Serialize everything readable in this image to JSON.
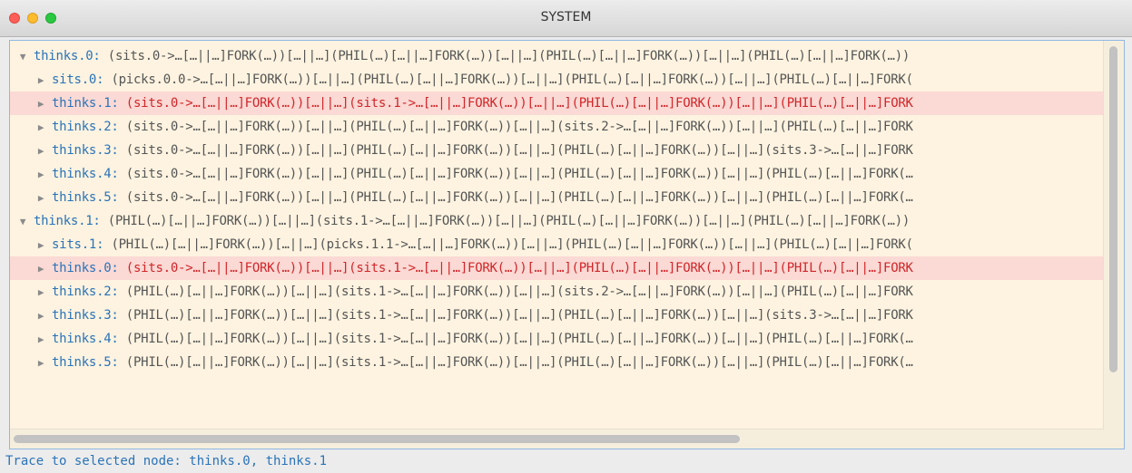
{
  "window": {
    "title": "SYSTEM"
  },
  "tree": {
    "rows": [
      {
        "level": 0,
        "expanded": true,
        "selected": false,
        "name": "thinks.0:",
        "text": " (sits.0->…[…||…]FORK(…))[…||…](PHIL(…)[…||…]FORK(…))[…||…](PHIL(…)[…||…]FORK(…))[…||…](PHIL(…)[…||…]FORK(…))"
      },
      {
        "level": 1,
        "expanded": false,
        "selected": false,
        "name": "sits.0:",
        "text": " (picks.0.0->…[…||…]FORK(…))[…||…](PHIL(…)[…||…]FORK(…))[…||…](PHIL(…)[…||…]FORK(…))[…||…](PHIL(…)[…||…]FORK("
      },
      {
        "level": 1,
        "expanded": false,
        "selected": true,
        "name": "thinks.1:",
        "text": " (sits.0->…[…||…]FORK(…))[…||…](sits.1->…[…||…]FORK(…))[…||…](PHIL(…)[…||…]FORK(…))[…||…](PHIL(…)[…||…]FORK"
      },
      {
        "level": 1,
        "expanded": false,
        "selected": false,
        "name": "thinks.2:",
        "text": " (sits.0->…[…||…]FORK(…))[…||…](PHIL(…)[…||…]FORK(…))[…||…](sits.2->…[…||…]FORK(…))[…||…](PHIL(…)[…||…]FORK"
      },
      {
        "level": 1,
        "expanded": false,
        "selected": false,
        "name": "thinks.3:",
        "text": " (sits.0->…[…||…]FORK(…))[…||…](PHIL(…)[…||…]FORK(…))[…||…](PHIL(…)[…||…]FORK(…))[…||…](sits.3->…[…||…]FORK"
      },
      {
        "level": 1,
        "expanded": false,
        "selected": false,
        "name": "thinks.4:",
        "text": " (sits.0->…[…||…]FORK(…))[…||…](PHIL(…)[…||…]FORK(…))[…||…](PHIL(…)[…||…]FORK(…))[…||…](PHIL(…)[…||…]FORK(…"
      },
      {
        "level": 1,
        "expanded": false,
        "selected": false,
        "name": "thinks.5:",
        "text": " (sits.0->…[…||…]FORK(…))[…||…](PHIL(…)[…||…]FORK(…))[…||…](PHIL(…)[…||…]FORK(…))[…||…](PHIL(…)[…||…]FORK(…"
      },
      {
        "level": 0,
        "expanded": true,
        "selected": false,
        "name": "thinks.1:",
        "text": " (PHIL(…)[…||…]FORK(…))[…||…](sits.1->…[…||…]FORK(…))[…||…](PHIL(…)[…||…]FORK(…))[…||…](PHIL(…)[…||…]FORK(…))"
      },
      {
        "level": 1,
        "expanded": false,
        "selected": false,
        "name": "sits.1:",
        "text": " (PHIL(…)[…||…]FORK(…))[…||…](picks.1.1->…[…||…]FORK(…))[…||…](PHIL(…)[…||…]FORK(…))[…||…](PHIL(…)[…||…]FORK("
      },
      {
        "level": 1,
        "expanded": false,
        "selected": true,
        "name": "thinks.0:",
        "text": " (sits.0->…[…||…]FORK(…))[…||…](sits.1->…[…||…]FORK(…))[…||…](PHIL(…)[…||…]FORK(…))[…||…](PHIL(…)[…||…]FORK"
      },
      {
        "level": 1,
        "expanded": false,
        "selected": false,
        "name": "thinks.2:",
        "text": " (PHIL(…)[…||…]FORK(…))[…||…](sits.1->…[…||…]FORK(…))[…||…](sits.2->…[…||…]FORK(…))[…||…](PHIL(…)[…||…]FORK"
      },
      {
        "level": 1,
        "expanded": false,
        "selected": false,
        "name": "thinks.3:",
        "text": " (PHIL(…)[…||…]FORK(…))[…||…](sits.1->…[…||…]FORK(…))[…||…](PHIL(…)[…||…]FORK(…))[…||…](sits.3->…[…||…]FORK"
      },
      {
        "level": 1,
        "expanded": false,
        "selected": false,
        "name": "thinks.4:",
        "text": " (PHIL(…)[…||…]FORK(…))[…||…](sits.1->…[…||…]FORK(…))[…||…](PHIL(…)[…||…]FORK(…))[…||…](PHIL(…)[…||…]FORK(…"
      },
      {
        "level": 1,
        "expanded": false,
        "selected": false,
        "name": "thinks.5:",
        "text": " (PHIL(…)[…||…]FORK(…))[…||…](sits.1->…[…||…]FORK(…))[…||…](PHIL(…)[…||…]FORK(…))[…||…](PHIL(…)[…||…]FORK(…"
      }
    ]
  },
  "status": {
    "text": "Trace to selected node: thinks.0, thinks.1"
  }
}
